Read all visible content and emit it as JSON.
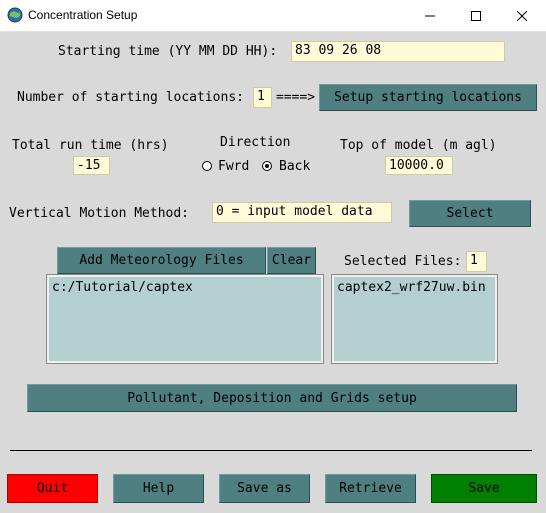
{
  "window": {
    "title": "Concentration Setup"
  },
  "start_time": {
    "label": "Starting time (YY MM DD HH):",
    "value": "83 09 26 08"
  },
  "locations": {
    "label": "Number of starting locations:",
    "value": "1",
    "arrow": "====>",
    "setup_button": "Setup starting locations"
  },
  "run_time": {
    "label": "Total run time (hrs)",
    "value": "-15"
  },
  "direction": {
    "label": "Direction",
    "fwrd": "Fwrd",
    "back": "Back",
    "selected": "Back"
  },
  "top_model": {
    "label": "Top of model (m agl)",
    "value": "10000.0"
  },
  "vertical": {
    "label": "Vertical Motion Method:",
    "value": "0 = input model data",
    "select_button": "Select"
  },
  "met": {
    "add_button": "Add Meteorology Files",
    "clear_button": "Clear",
    "selected_label": "Selected Files:",
    "selected_count": "1",
    "dir_list": [
      "c:/Tutorial/captex"
    ],
    "file_list": [
      "captex2_wrf27uw.bin"
    ]
  },
  "pollutant_button": "Pollutant, Deposition and Grids setup",
  "footer": {
    "quit": "Quit",
    "help": "Help",
    "save_as": "Save as",
    "retrieve": "Retrieve",
    "save": "Save",
    "colors": {
      "quit": "#ff0000",
      "save": "#008000",
      "default": "#4f7f80"
    }
  }
}
